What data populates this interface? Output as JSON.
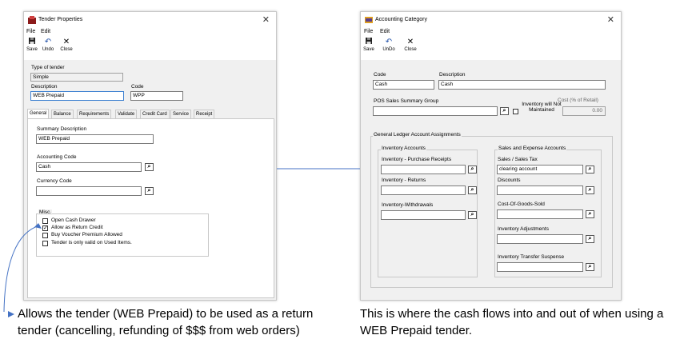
{
  "tender_window": {
    "title": "Tender Properties",
    "menu": [
      "File",
      "Edit"
    ],
    "toolbar": {
      "save": "Save",
      "undo": "Undo",
      "close": "Close"
    },
    "type_label": "Type of tender",
    "type_value": "Simple",
    "description_label": "Description",
    "description_value": "WEB Prepaid",
    "code_label": "Code",
    "code_value": "WPP",
    "tabs": [
      "General",
      "Balance",
      "Requirements",
      "Validate",
      "Credit Card",
      "Service",
      "Receipt"
    ],
    "summary_label": "Summary Description",
    "summary_value": "WEB Prepaid",
    "accounting_label": "Accounting Code",
    "accounting_value": "Cash",
    "currency_label": "Currency Code",
    "currency_value": "",
    "misc_label": "Misc.",
    "misc_items": [
      {
        "label": "Open Cash Drawer",
        "checked": false
      },
      {
        "label": "Allow as Return Credit",
        "checked": true
      },
      {
        "label": "Buy Voucher Premium Allowed",
        "checked": false
      },
      {
        "label": "Tender is only valid on Used Items.",
        "checked": false
      }
    ]
  },
  "category_window": {
    "title": "Accounting Category",
    "menu": [
      "File",
      "Edit"
    ],
    "toolbar": {
      "save": "Save",
      "undo": "UnDo",
      "close": "Close"
    },
    "code_label": "Code",
    "code_value": "Cash",
    "description_label": "Description",
    "description_value": "Cash",
    "pos_label": "POS Sales Summary Group",
    "pos_value": "",
    "inventory_will_label": "Inventory will Not Maintained",
    "cost_label": "Cost (% of Retail)",
    "cost_value": "0.00",
    "gl_label": "General Ledger Account Assignments",
    "inventory_accounts_label": "Inventory Accounts",
    "sales_accounts_label": "Sales and Expense Accounts",
    "inv_fields": [
      {
        "label": "Inventory - Purchase Receipts",
        "value": ""
      },
      {
        "label": "Inventory - Returns",
        "value": ""
      },
      {
        "label": "Inventory-Withdrawals",
        "value": ""
      }
    ],
    "sales_fields": [
      {
        "label": "Sales / Sales Tax",
        "value": "clearing account"
      },
      {
        "label": "Discounts",
        "value": ""
      },
      {
        "label": "Cost-Of-Goods-Sold",
        "value": ""
      },
      {
        "label": "Inventory Adjustments",
        "value": ""
      },
      {
        "label": "Inventory Transfer Suspense",
        "value": ""
      }
    ]
  },
  "captions": {
    "left": "Allows the tender (WEB Prepaid) to be used as a return tender (cancelling, refunding of $$$ from web orders)",
    "right": "This is where the cash flows into and out of when using a WEB Prepaid tender."
  },
  "colors": {
    "connector": "#4472c4",
    "window_bg": "#f0f0f0"
  },
  "icons": {
    "save": "floppy-disk-icon",
    "undo": "undo-arrow-icon",
    "close": "close-x-icon",
    "find": "binoculars-icon"
  }
}
